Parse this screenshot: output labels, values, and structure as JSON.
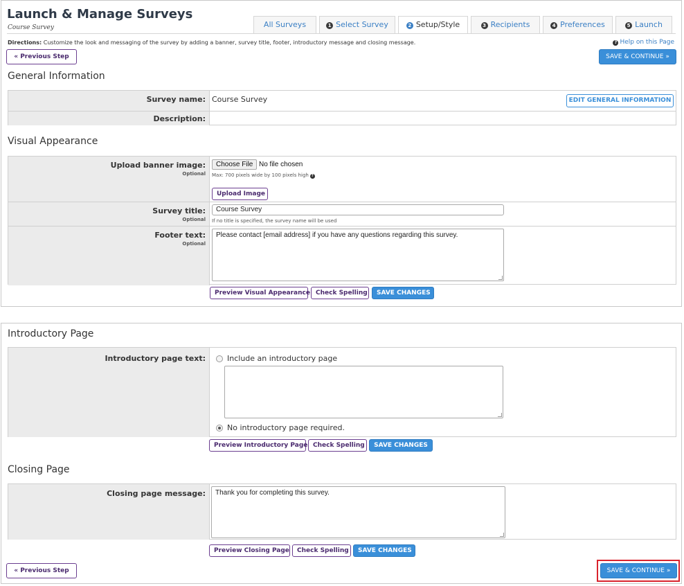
{
  "header": {
    "title": "Launch & Manage Surveys",
    "subtitle": "Course Survey"
  },
  "tabs": [
    {
      "label": "All Surveys",
      "num": ""
    },
    {
      "label": "Select Survey",
      "num": "1"
    },
    {
      "label": "Setup/Style",
      "num": "2"
    },
    {
      "label": "Recipients",
      "num": "3"
    },
    {
      "label": "Preferences",
      "num": "4"
    },
    {
      "label": "Launch",
      "num": "5"
    }
  ],
  "directions": {
    "label": "Directions:",
    "text": " Customize the look and messaging of the survey by adding a banner, survey title, footer, introductory message and closing message.",
    "help": "Help on this Page"
  },
  "nav": {
    "prev": "« Previous Step",
    "save_continue": "SAVE & CONTINUE »"
  },
  "general": {
    "title": "General Information",
    "name_label": "Survey name:",
    "name_value": "Course Survey",
    "edit_btn": "EDIT GENERAL INFORMATION",
    "desc_label": "Description:"
  },
  "visual": {
    "title": "Visual Appearance",
    "banner_label": "Upload banner image:",
    "optional": "Optional",
    "choose_file": "Choose File",
    "no_file": "No file chosen",
    "banner_hint": "Max: 700 pixels wide by 100 pixels high",
    "upload_btn": "Upload Image",
    "survey_title_label": "Survey title:",
    "survey_title_value": "Course Survey",
    "survey_title_hint": "If no title is specified, the survey name will be used",
    "footer_label": "Footer text:",
    "footer_value": "Please contact [email address] if you have any questions regarding this survey.",
    "preview_btn": "Preview Visual Appearance"
  },
  "common": {
    "check_spelling": "Check Spelling",
    "save_changes": "SAVE CHANGES"
  },
  "intro": {
    "title": "Introductory Page",
    "label": "Introductory page text:",
    "option_include": "Include an introductory page",
    "option_none": "No introductory page required.",
    "selected": "none",
    "preview_btn": "Preview Introductory Page"
  },
  "closing": {
    "title": "Closing Page",
    "label": "Closing page message:",
    "value": "Thank you for completing this survey.",
    "preview_btn": "Preview Closing Page"
  },
  "colors": {
    "accent": "#3a8fd9",
    "purple": "#4a2a6e",
    "highlight": "#d9232d"
  }
}
